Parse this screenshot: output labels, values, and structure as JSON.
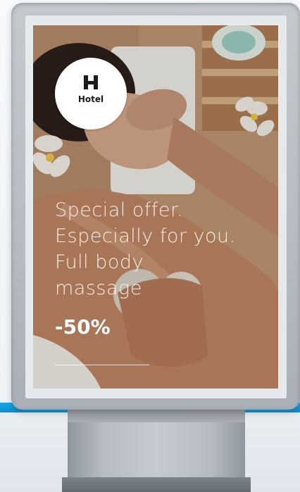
{
  "brand": {
    "logo_text": "Hotel",
    "logo_icon": "hotel-h-icon"
  },
  "headline": {
    "lines": [
      "Special offer.",
      "Especially for you.",
      "Full body",
      "massage"
    ],
    "discount": "-50%"
  },
  "colors": {
    "frame": "#b5bbc1",
    "accent_strip": "#17a7e8",
    "text": "#f6eee6"
  }
}
